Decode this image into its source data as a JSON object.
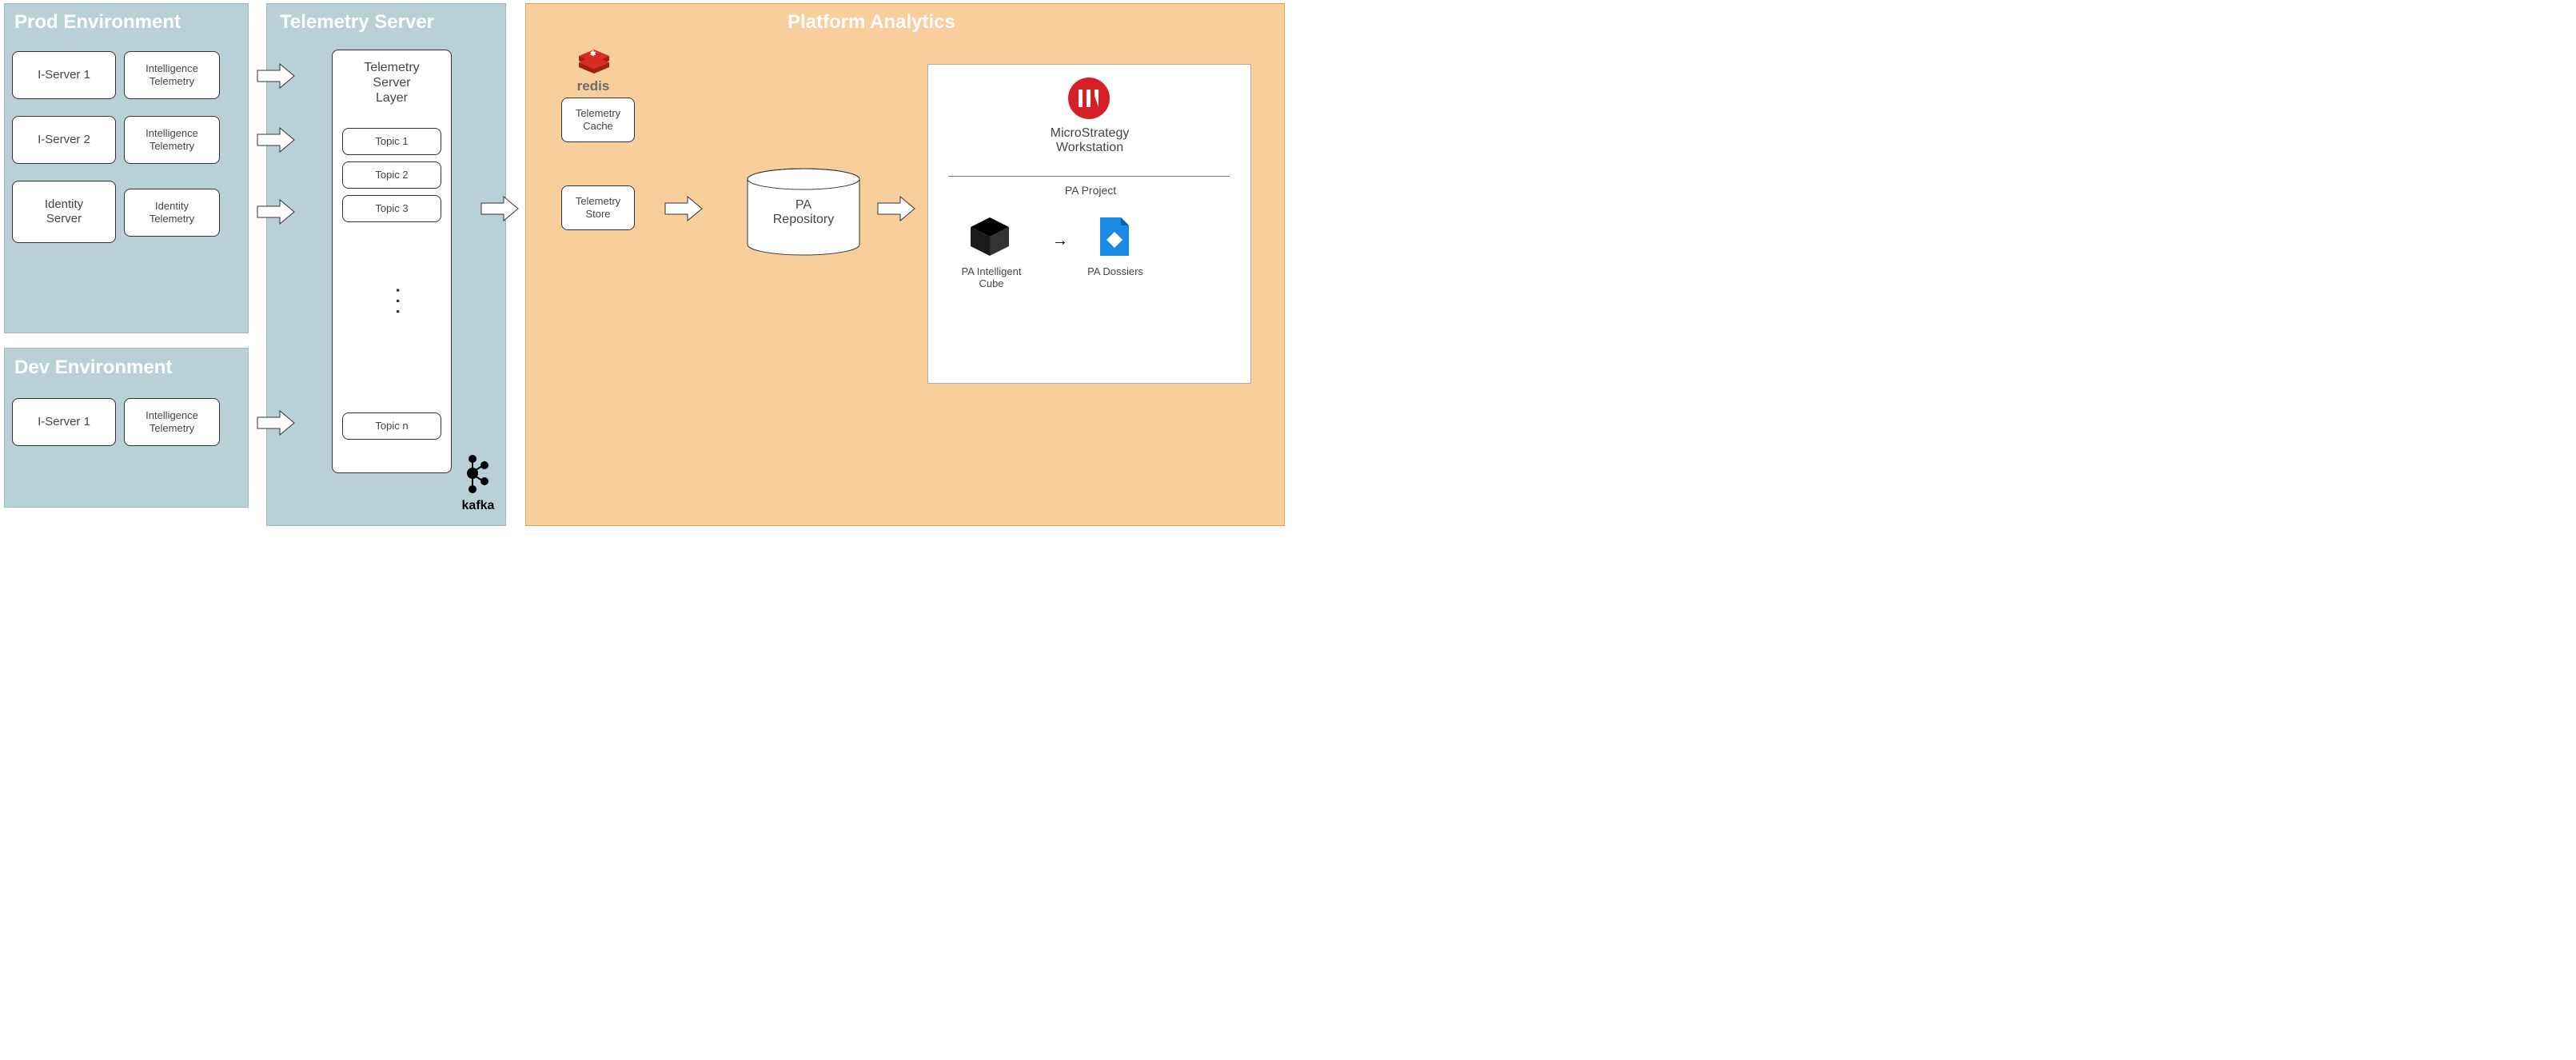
{
  "prod_env": {
    "title": "Prod Environment",
    "iserver1": "I-Server 1",
    "iserver2": "I-Server 2",
    "identity_server": "Identity\nServer",
    "int_telem1": "Intelligence\nTelemetry",
    "int_telem2": "Intelligence\nTelemetry",
    "id_telem": "Identity\nTelemetry"
  },
  "dev_env": {
    "title": "Dev Environment",
    "iserver1": "I-Server 1",
    "int_telem": "Intelligence\nTelemetry"
  },
  "telem_server": {
    "title": "Telemetry Server",
    "layer": "Telemetry\nServer\nLayer",
    "topic1": "Topic 1",
    "topic2": "Topic 2",
    "topic3": "Topic 3",
    "topicn": "Topic n",
    "kafka": "kafka"
  },
  "platform": {
    "title": "Platform Analytics",
    "redis": "redis",
    "telem_cache": "Telemetry\nCache",
    "telem_store": "Telemetry\nStore",
    "pa_repo": "PA\nRepository",
    "workstation": "MicroStrategy\nWorkstation",
    "pa_project": "PA Project",
    "pa_cube": "PA Intelligent\nCube",
    "pa_dossiers": "PA Dossiers"
  }
}
